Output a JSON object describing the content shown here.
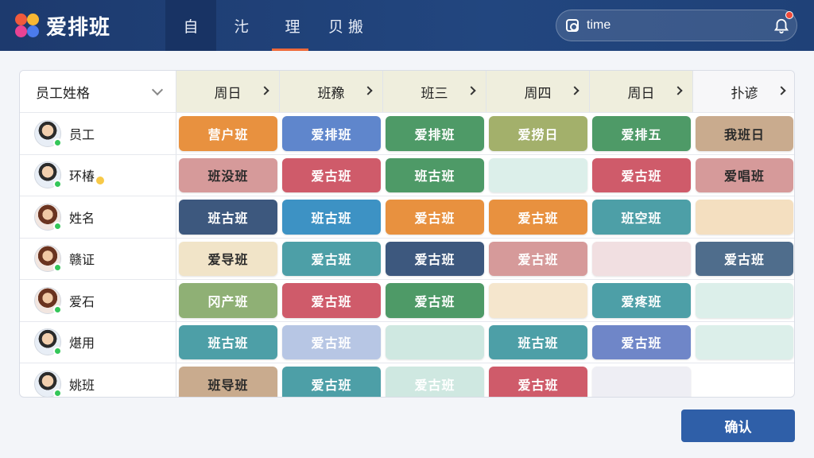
{
  "app": {
    "title": "爱排班"
  },
  "nav": {
    "tabs": [
      "自",
      "㲺",
      "理",
      "贝 搬"
    ]
  },
  "search": {
    "value": "time"
  },
  "colors": {
    "orange": "#e8913f",
    "blue": "#5f86cc",
    "green": "#4e9a67",
    "olive": "#a3b06b",
    "tan": "#c9ab8e",
    "rose": "#d69a9a",
    "red": "#cf5b6a",
    "navy": "#3d587e",
    "sky": "#3d92c4",
    "teal": "#4d9fa7",
    "cream": "#f1e4c8",
    "pale": "#e3ecea",
    "pink": "#f1dfe1",
    "lavender": "#e4e6f4",
    "peach": "#f4dfc0",
    "periwinkle": "#6f86c8",
    "sage": "#8fb075",
    "slate": "#4f6d8c",
    "wheat": "#f5e6cd",
    "mint": "#dcefea",
    "blank": "#ffffff",
    "softblue": "#b7c6e4",
    "softgreen": "#cfe8e1",
    "lightgray": "#eeeef4"
  },
  "grid": {
    "name_header": "员工姓格",
    "days": [
      "周日",
      "班䂊",
      "班三",
      "周四",
      "周日",
      "扑谚"
    ],
    "rows": [
      {
        "name": "员工",
        "gender": "m",
        "badge": false,
        "cells": [
          {
            "label": "营户班",
            "color": "orange"
          },
          {
            "label": "爱排班",
            "color": "blue"
          },
          {
            "label": "爱排班",
            "color": "green"
          },
          {
            "label": "爱捞日",
            "color": "olive"
          },
          {
            "label": "爱排五",
            "color": "green"
          },
          {
            "label": "我班日",
            "color": "tan",
            "dark": true
          }
        ]
      },
      {
        "name": "环椿",
        "gender": "m",
        "badge": true,
        "cells": [
          {
            "label": "班没班",
            "color": "rose",
            "dark": true
          },
          {
            "label": "爱古班",
            "color": "red"
          },
          {
            "label": "班古班",
            "color": "green"
          },
          {
            "label": "",
            "color": "mint"
          },
          {
            "label": "爱古班",
            "color": "red"
          },
          {
            "label": "爱唱班",
            "color": "rose",
            "dark": true
          }
        ]
      },
      {
        "name": "姓名",
        "gender": "f",
        "badge": false,
        "cells": [
          {
            "label": "班古班",
            "color": "navy"
          },
          {
            "label": "班古班",
            "color": "sky"
          },
          {
            "label": "爱古班",
            "color": "orange"
          },
          {
            "label": "爱古班",
            "color": "orange"
          },
          {
            "label": "班空班",
            "color": "teal"
          },
          {
            "label": "",
            "color": "peach"
          }
        ]
      },
      {
        "name": "赣证",
        "gender": "f",
        "badge": false,
        "cells": [
          {
            "label": "爱导班",
            "color": "cream",
            "dark": true
          },
          {
            "label": "爱古班",
            "color": "teal"
          },
          {
            "label": "爱古班",
            "color": "navy"
          },
          {
            "label": "爱古班",
            "color": "rose"
          },
          {
            "label": "",
            "color": "pink"
          },
          {
            "label": "爱古班",
            "color": "slate"
          }
        ]
      },
      {
        "name": "爱石",
        "gender": "f",
        "badge": false,
        "cells": [
          {
            "label": "冈产班",
            "color": "sage"
          },
          {
            "label": "爱古班",
            "color": "red"
          },
          {
            "label": "爱古班",
            "color": "green"
          },
          {
            "label": "",
            "color": "wheat"
          },
          {
            "label": "爱疼班",
            "color": "teal"
          },
          {
            "label": "",
            "color": "mint"
          }
        ]
      },
      {
        "name": "煁用",
        "gender": "m",
        "badge": false,
        "cells": [
          {
            "label": "班古班",
            "color": "teal"
          },
          {
            "label": "爱古班",
            "color": "softblue"
          },
          {
            "label": "",
            "color": "softgreen"
          },
          {
            "label": "班古班",
            "color": "teal"
          },
          {
            "label": "爱古班",
            "color": "periwinkle"
          },
          {
            "label": "",
            "color": "mint"
          }
        ]
      },
      {
        "name": "姚班",
        "gender": "m",
        "badge": false,
        "cells": [
          {
            "label": "班导班",
            "color": "tan",
            "dark": true
          },
          {
            "label": "爱古班",
            "color": "teal"
          },
          {
            "label": "爱古班",
            "color": "softgreen"
          },
          {
            "label": "爱古班",
            "color": "red"
          },
          {
            "label": "",
            "color": "lightgray"
          },
          {
            "label": "",
            "color": "blank"
          }
        ]
      }
    ]
  },
  "footer": {
    "confirm_label": "确认"
  }
}
